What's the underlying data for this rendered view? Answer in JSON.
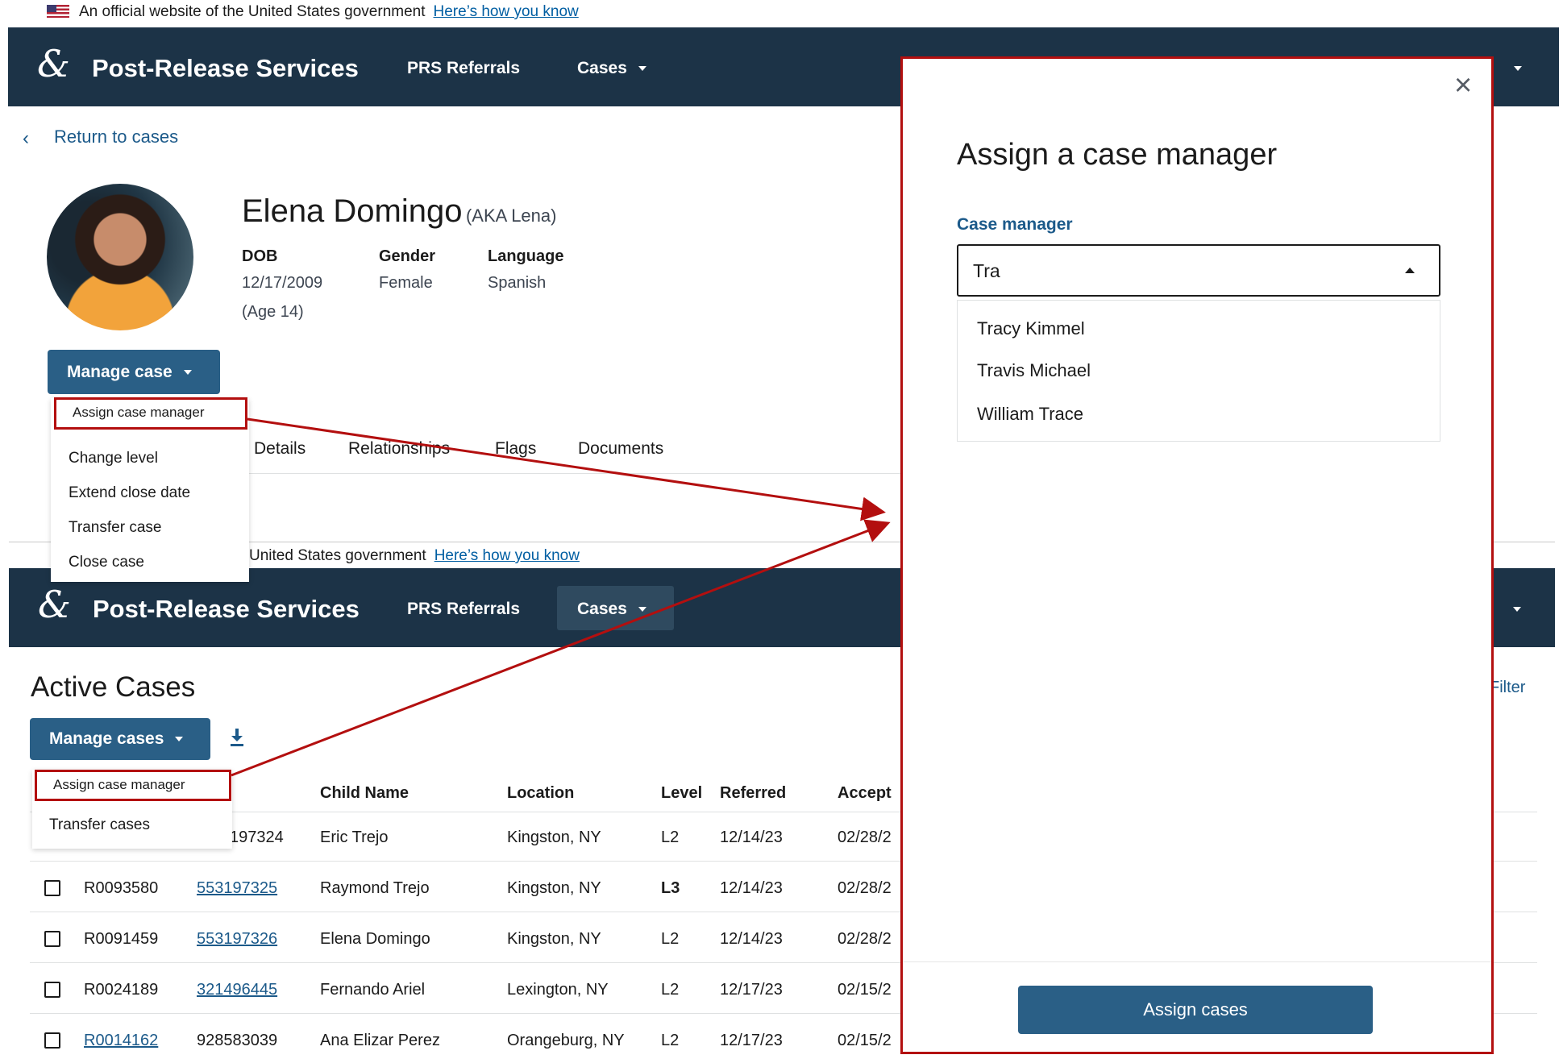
{
  "top_page": {
    "banner": {
      "text": "An official website of the United States government",
      "link": "Here’s how you know"
    },
    "app": {
      "logo": "&",
      "title": "Post-Release Services",
      "nav": {
        "referrals": "PRS Referrals",
        "cases": "Cases"
      }
    },
    "return_link": "Return to cases",
    "person": {
      "name": "Elena Domingo",
      "aka": "(AKA Lena)",
      "dob_label": "DOB",
      "dob": "12/17/2009",
      "age": "(Age 14)",
      "gender_label": "Gender",
      "gender": "Female",
      "language_label": "Language",
      "language": "Spanish"
    },
    "manage_button": "Manage case",
    "menu": [
      "Assign case manager",
      "Change level",
      "Extend close date",
      "Transfer case",
      "Close case"
    ],
    "tabs": [
      "Details",
      "Relationships",
      "Flags",
      "Documents"
    ]
  },
  "bottom_page": {
    "banner": {
      "text": "United States government",
      "link": "Here’s how you know"
    },
    "app": {
      "logo": "&",
      "title": "Post-Release Services",
      "nav": {
        "referrals": "PRS Referrals",
        "cases": "Cases"
      }
    },
    "heading": "Active Cases",
    "filter_link": "Filter",
    "manage_button": "Manage cases",
    "menu": [
      "Assign case manager",
      "Transfer cases"
    ],
    "columns": [
      "Child Name",
      "Location",
      "Level",
      "Referred",
      "Accept"
    ],
    "rows": [
      {
        "case_id": "",
        "a_number": "197324",
        "name": "Eric Trejo",
        "location": "Kingston, NY",
        "level": "L2",
        "referred": "12/14/23",
        "accepted": "02/28/2"
      },
      {
        "case_id": "R0093580",
        "a_number": "553197325",
        "name": "Raymond Trejo",
        "location": "Kingston, NY",
        "level": "L3",
        "referred": "12/14/23",
        "accepted": "02/28/2"
      },
      {
        "case_id": "R0091459",
        "a_number": "553197326",
        "name": "Elena Domingo",
        "location": "Kingston, NY",
        "level": "L2",
        "referred": "12/14/23",
        "accepted": "02/28/2"
      },
      {
        "case_id": "R0024189",
        "a_number": "321496445",
        "name": "Fernando Ariel",
        "location": "Lexington, NY",
        "level": "L2",
        "referred": "12/17/23",
        "accepted": "02/15/2"
      },
      {
        "case_id": "R0014162",
        "a_number": "928583039",
        "name": "Ana Elizar Perez",
        "location": "Orangeburg, NY",
        "level": "L2",
        "referred": "12/17/23",
        "accepted": "02/15/2"
      }
    ]
  },
  "modal": {
    "close_icon": "×",
    "title": "Assign a case manager",
    "field_label": "Case manager",
    "input_value": "Tra",
    "options": [
      "Tracy Kimmel",
      "Travis Michael",
      "William Trace"
    ],
    "submit": "Assign cases"
  },
  "colors": {
    "navbar": "#1c3347",
    "primary_button": "#2a5f86",
    "link": "#1c5a8a",
    "highlight": "#b30f0f"
  }
}
